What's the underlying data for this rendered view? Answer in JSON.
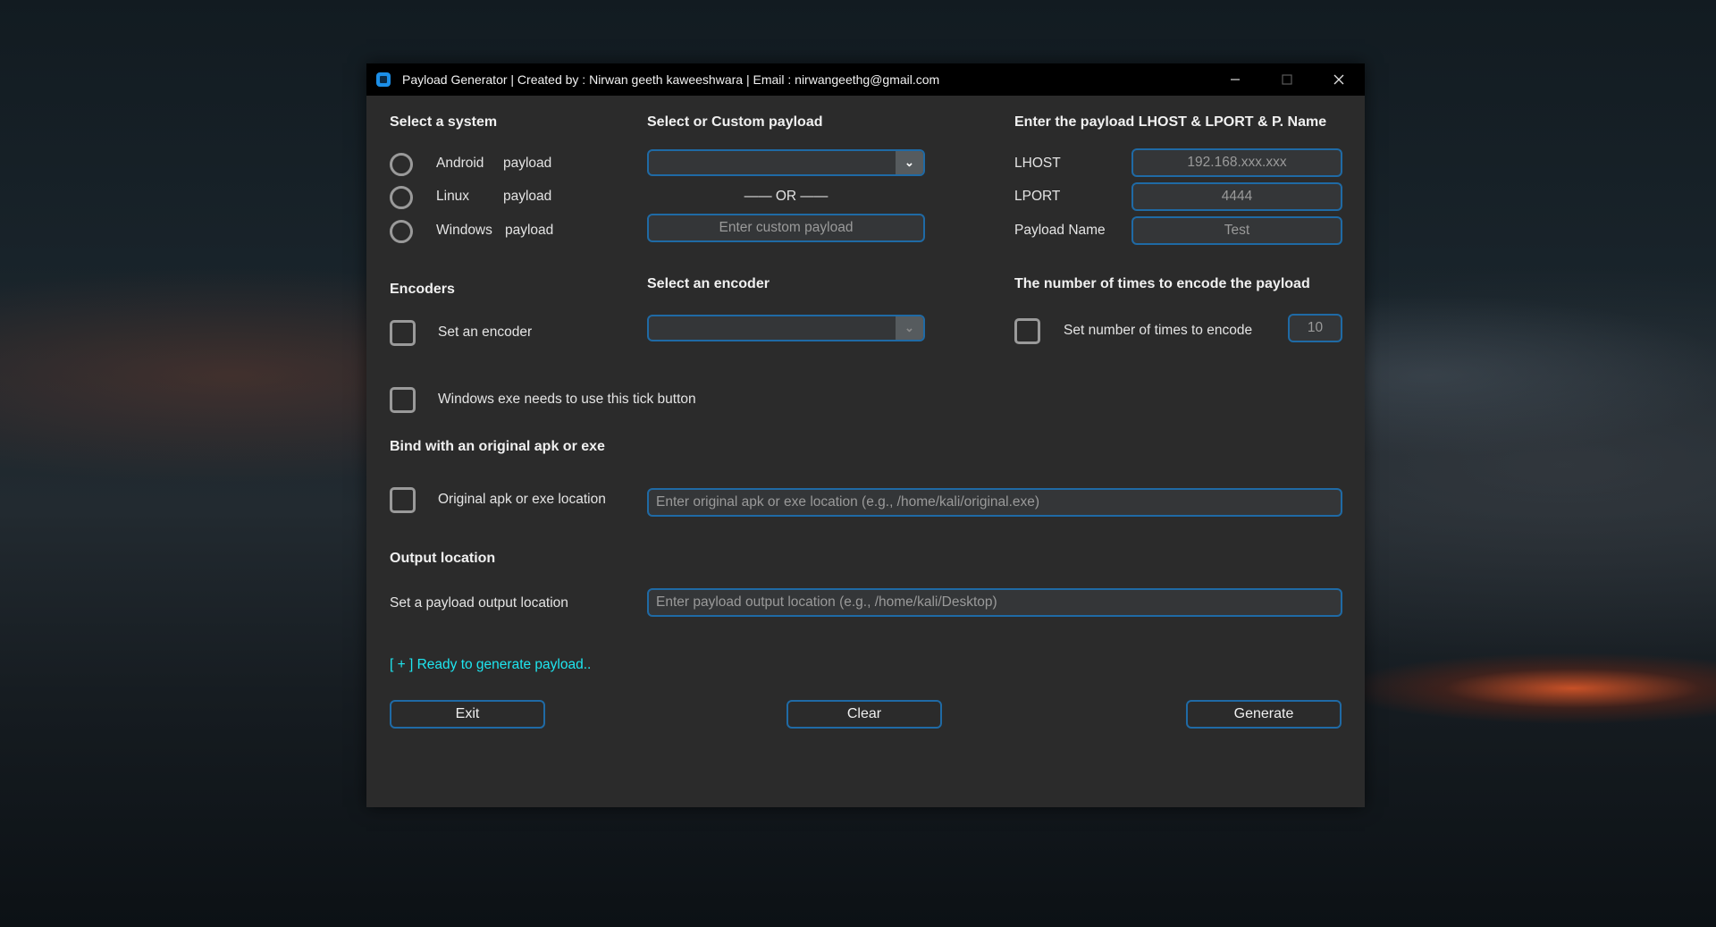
{
  "window": {
    "title": "Payload Generator | Created by : Nirwan geeth kaweeshwara | Email : nirwangeethg@gmail.com",
    "minimize_icon": "minimize-icon",
    "maximize_icon": "maximize-icon",
    "close_icon": "close-icon"
  },
  "system": {
    "heading": "Select a system",
    "options": [
      {
        "name": "Android",
        "suffix": "payload"
      },
      {
        "name": "Linux",
        "suffix": "payload"
      },
      {
        "name": "Windows",
        "suffix": "payload"
      }
    ]
  },
  "payload": {
    "heading": "Select or Custom payload",
    "select_value": "",
    "or_label": "—— OR ——",
    "custom_placeholder": "Enter custom payload"
  },
  "connection": {
    "heading": "Enter the payload LHOST & LPORT & P. Name",
    "lhost_label": "LHOST",
    "lhost_value": "192.168.xxx.xxx",
    "lport_label": "LPORT",
    "lport_value": "4444",
    "name_label": "Payload Name",
    "name_value": "Test"
  },
  "encoders": {
    "heading": "Encoders",
    "checkbox_label": "Set an encoder",
    "select_heading": "Select an encoder",
    "select_value": "",
    "times_heading": "The number of times to encode the payload",
    "times_checkbox_label": "Set number of times to encode",
    "times_value": "10"
  },
  "windows_exe": {
    "checkbox_label": "Windows exe needs to use this tick button"
  },
  "bind": {
    "heading": "Bind with an original apk or exe",
    "checkbox_label": "Original apk or exe location",
    "placeholder": "Enter original apk or exe location (e.g., /home/kali/original.exe)"
  },
  "output": {
    "heading": "Output location",
    "label": "Set a payload output location",
    "placeholder": "Enter payload output location (e.g., /home/kali/Desktop)"
  },
  "status": {
    "text": "[ + ]  Ready to generate payload.."
  },
  "buttons": {
    "exit": "Exit",
    "clear": "Clear",
    "generate": "Generate"
  },
  "colors": {
    "accent": "#1f6aa5",
    "status": "#1ee6f0",
    "window_bg": "#2b2b2b"
  }
}
